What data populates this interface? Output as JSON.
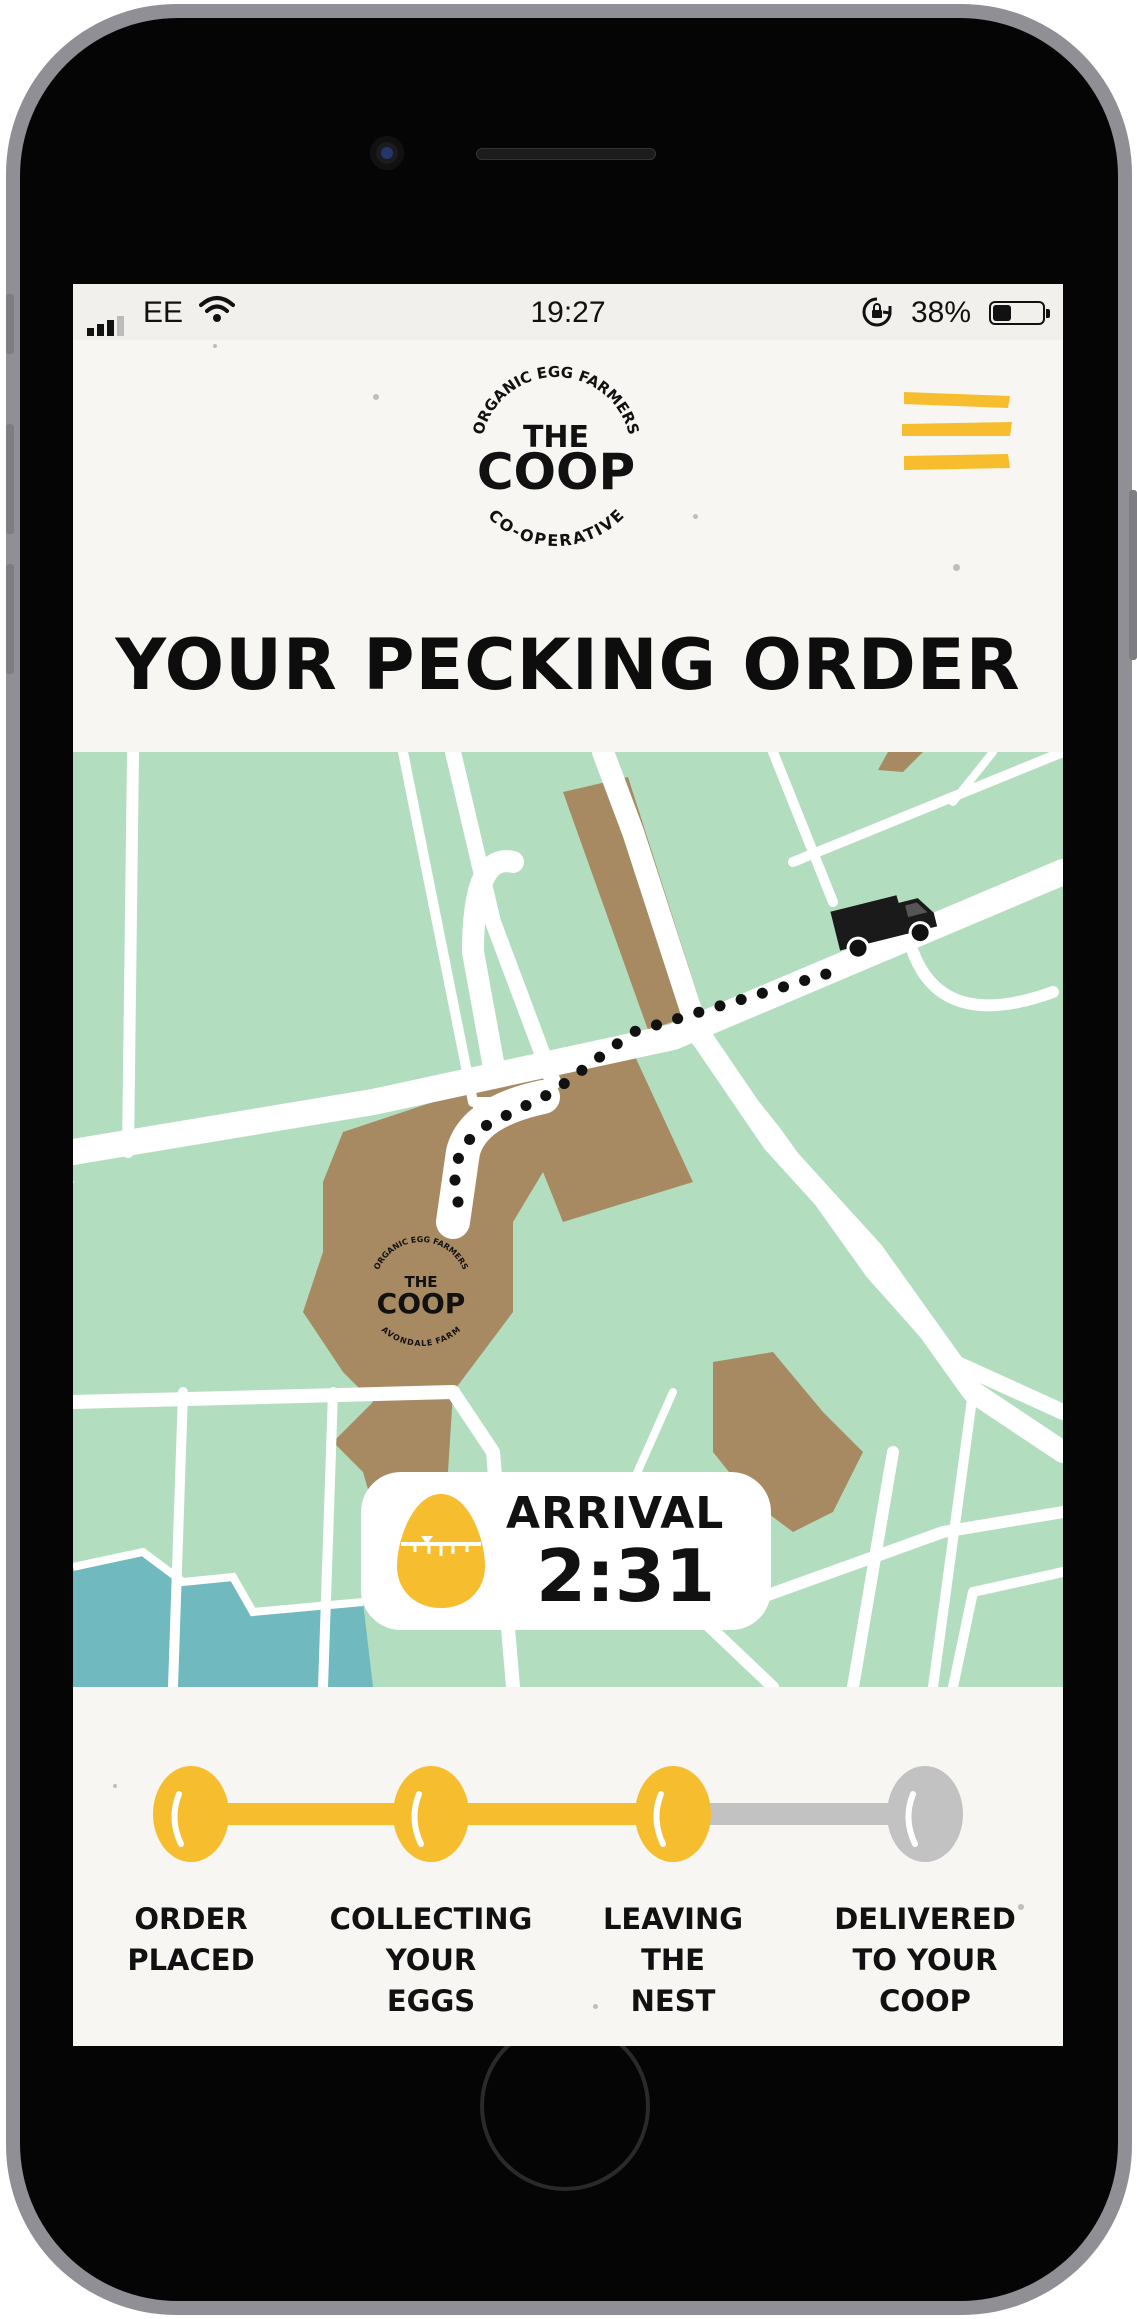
{
  "status_bar": {
    "carrier": "EE",
    "time": "19:27",
    "battery_percent": "38%",
    "battery_level": 0.38,
    "icons": [
      "signal-icon",
      "wifi-icon",
      "orientation-lock-icon",
      "battery-icon"
    ]
  },
  "header": {
    "logo": {
      "top_text": "ORGANIC EGG FARMERS",
      "line1": "THE",
      "line2": "COOP",
      "bottom_text": "CO-OPERATIVE"
    },
    "menu_icon": "hamburger-menu-icon"
  },
  "page_title": "YOUR PECKING ORDER",
  "map": {
    "farm_logo": {
      "top_text": "ORGANIC EGG FARMERS",
      "line1": "THE",
      "line2": "COOP",
      "bottom_text": "AVONDALE FARM"
    },
    "vehicle_icon": "delivery-van-icon"
  },
  "arrival": {
    "label": "ARRIVAL",
    "time": "2:31",
    "icon": "egg-timer-icon"
  },
  "progress": {
    "steps": [
      {
        "label": "ORDER\nPLACED",
        "complete": true
      },
      {
        "label": "COLLECTING\nYOUR\nEGGS",
        "complete": true
      },
      {
        "label": "LEAVING\nTHE\nNEST",
        "complete": true
      },
      {
        "label": "DELIVERED\nTO YOUR\nCOOP",
        "complete": false
      }
    ],
    "fraction_complete": 0.7
  },
  "colors": {
    "accent_yellow": "#f6bd2f",
    "map_green": "#b2ddbf",
    "map_brown": "#a78a62",
    "map_water": "#6fb9bf",
    "pending_grey": "#c2c2c2",
    "ink": "#111111"
  }
}
